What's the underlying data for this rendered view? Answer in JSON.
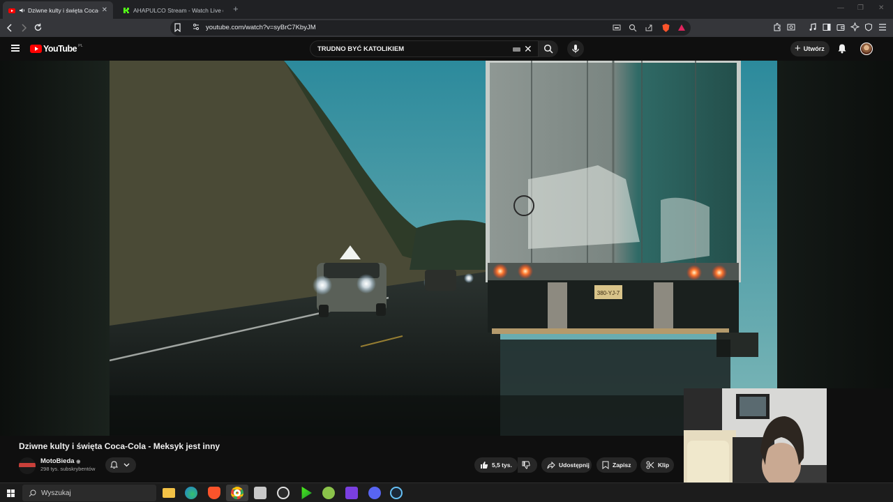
{
  "tabs": [
    {
      "title": "Dziwne kulty i święta Coca-C",
      "favicon": "youtube-icon",
      "active": true,
      "audio_icon": "speaker-icon"
    },
    {
      "title": "AHAPULCO Stream - Watch Live on K",
      "favicon": "kick-icon",
      "active": false
    }
  ],
  "address_bar": {
    "url": "youtube.com/watch?v=syBrC7KbyJM"
  },
  "youtube": {
    "logo_text": "YouTube",
    "country_code": "PL",
    "search_value": "TRUDNO BYĆ KATOLIKIEM",
    "create_label": "Utwórz"
  },
  "video": {
    "title": "Dziwne kulty i święta Coca-Cola - Meksyk jest inny",
    "channel_name": "MotoBieda",
    "subscribers": "298 tys. subskrybentów",
    "likes": "5,5 tys.",
    "share_label": "Udostępnij",
    "save_label": "Zapisz",
    "clip_label": "Klip",
    "truck_plate": "380-YJ-7"
  },
  "taskbar": {
    "search_placeholder": "Wyszukaj",
    "apps": [
      "file-explorer-icon",
      "edge-icon",
      "brave-icon",
      "chrome-icon",
      "app-icon",
      "obs-icon",
      "app-icon",
      "app-icon",
      "app-icon",
      "discord-icon",
      "steam-icon"
    ]
  },
  "colors": {
    "youtube_red": "#ff0000",
    "kick_green": "#53fc18",
    "brave_orange": "#fb542b"
  }
}
